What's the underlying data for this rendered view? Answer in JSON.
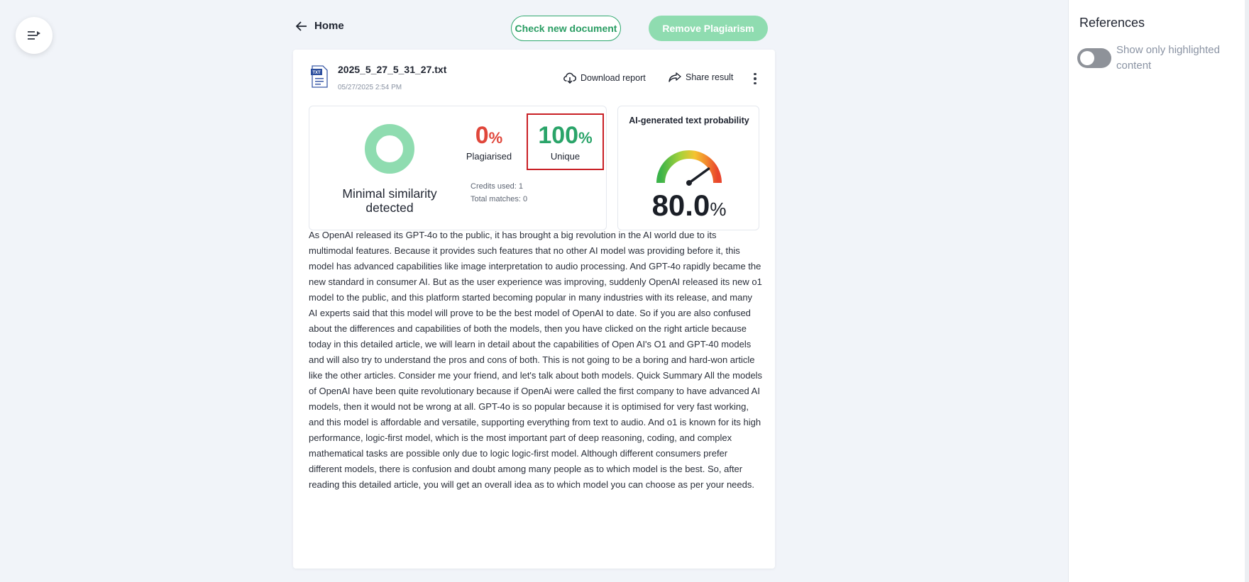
{
  "nav": {
    "home_label": "Home"
  },
  "toolbar": {
    "check_new_label": "Check new document",
    "remove_plagiarism_label": "Remove Plagiarism"
  },
  "report": {
    "file_name": "2025_5_27_5_31_27.txt",
    "file_date": "05/27/2025 2:54 PM",
    "file_badge": "TXT",
    "download_label": "Download report",
    "share_label": "Share result"
  },
  "similarity": {
    "summary": "Minimal similarity detected",
    "plagiarised_value": "0",
    "plagiarised_label": "Plagiarised",
    "unique_value": "100",
    "unique_label": "Unique",
    "percent_sign": "%",
    "credits_used": "Credits used: 1",
    "total_matches": "Total matches: 0"
  },
  "ai_detection": {
    "title": "AI-generated text probability",
    "value": "80.0",
    "percent_sign": "%",
    "gauge_level": 0.8
  },
  "article_text": "As OpenAI released its GPT-4o to the public, it has brought a big revolution in the AI world due to its multimodal features. Because it provides such features that no other AI model was providing before it, this model has advanced capabilities like image interpretation to audio processing. And GPT-4o rapidly became the new standard in consumer AI. But as the user experience was improving, suddenly OpenAI released its new o1 model to the public, and this platform started becoming popular in many industries with its release, and many AI experts said that this model will prove to be the best model of OpenAI to date. So if you are also confused about the differences and capabilities of both the models, then you have clicked on the right article because today in this detailed article, we will learn in detail about the capabilities of Open AI's O1 and GPT-40 models and will also try to understand the pros and cons of both. This is not going to be a boring and hard-won article like the other articles. Consider me your friend, and let's talk about both models. Quick Summary All the models of OpenAI have been quite revolutionary because if OpenAi were called the first company to have advanced AI models, then it would not be wrong at all. GPT-4o is so popular because it is optimised for very fast working, and this model is affordable and versatile, supporting everything from text to audio. And o1 is known for its high performance, logic-first model, which is the most important part of deep reasoning, coding, and complex mathematical tasks are possible only due to logic logic-first model. Although different consumers prefer different models, there is confusion and doubt among many people as to which model is the best. So, after reading this detailed article, you will get an overall idea as to which model you can choose as per your needs.",
  "references": {
    "title": "References",
    "toggle_label": "Show only highlighted content",
    "toggle_on": false
  },
  "colors": {
    "accent_green": "#2aa469",
    "button_fill": "#8fdcb0",
    "plagiarised_red": "#e0463a",
    "unique_frame": "#c91f25",
    "donut": "#8fdcb0"
  },
  "icons": {
    "menu": "menu-expand-icon",
    "home": "arrow-left-icon",
    "download": "cloud-download-icon",
    "share": "share-arrow-icon",
    "more": "more-vertical-icon",
    "file": "txt-file-icon",
    "gauge": "speedometer-gauge-icon"
  }
}
